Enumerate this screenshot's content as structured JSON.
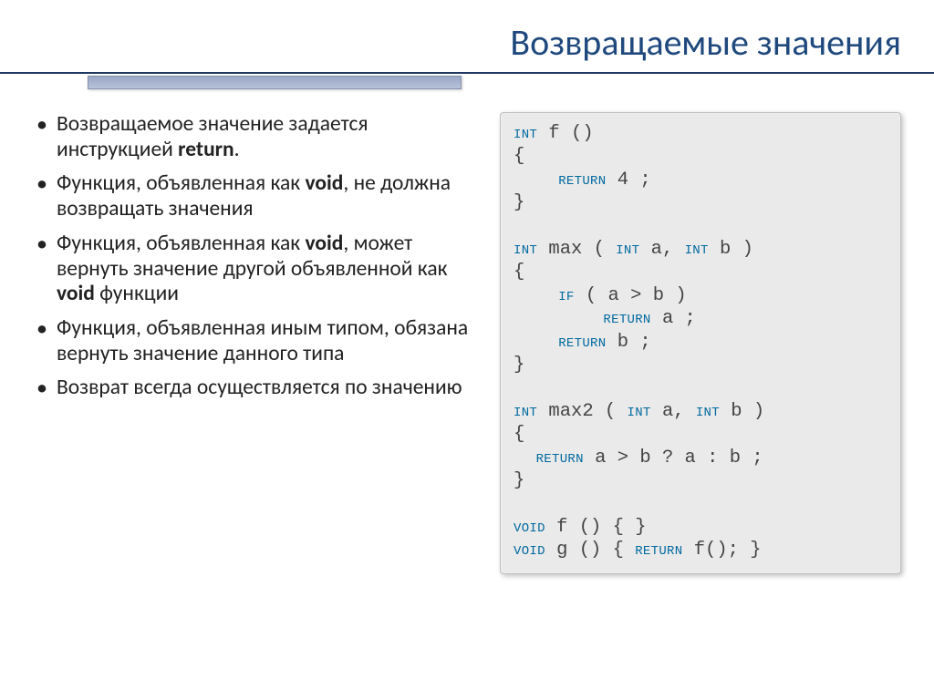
{
  "title": "Возвращаемые значения",
  "bullets": {
    "b1a": "Возвращаемое значение задается инструкцией ",
    "b1b": "return",
    "b1c": ".",
    "b2a": "Функция, объявленная как ",
    "b2b": "void",
    "b2c": ", не должна возвращать значения",
    "b3a": "Функция, объявленная как ",
    "b3b": "void",
    "b3c": ", может вернуть значение другой объявленной как ",
    "b3d": "void",
    "b3e": " функции",
    "b4": "Функция, объявленная иным типом, обязана вернуть значение данного типа",
    "b5": "Возврат всегда осуществляется по значению"
  },
  "code": {
    "l1_int": "int",
    "l1_rest": " f ()",
    "l2": "{",
    "l3_ret": "return",
    "l3_rest": " 4 ;",
    "l4": "}",
    "l5": "",
    "l6_int": "int",
    "l6_mid": " max ( ",
    "l6_inta": "int",
    "l6_a": " a, ",
    "l6_intb": "int",
    "l6_b": " b )",
    "l7": "{",
    "l8_if": "if",
    "l8_cond": " ( a > b )",
    "l9_ret": "return",
    "l9_rest": " a ;",
    "l10_ret": "return",
    "l10_rest": " b ;",
    "l11": "}",
    "l12": "",
    "l13_int": "int",
    "l13_mid": " max2 ( ",
    "l13_inta": "int",
    "l13_a": " a, ",
    "l13_intb": "int",
    "l13_b": " b )",
    "l14": "{",
    "l15_ret": "return",
    "l15_rest": " a > b ? a : b ;",
    "l16": "}",
    "l17": "",
    "l18_void": "void",
    "l18_rest": " f () { }",
    "l19_void": "void",
    "l19_g": " g () { ",
    "l19_ret": "return",
    "l19_rest": " f(); }"
  }
}
